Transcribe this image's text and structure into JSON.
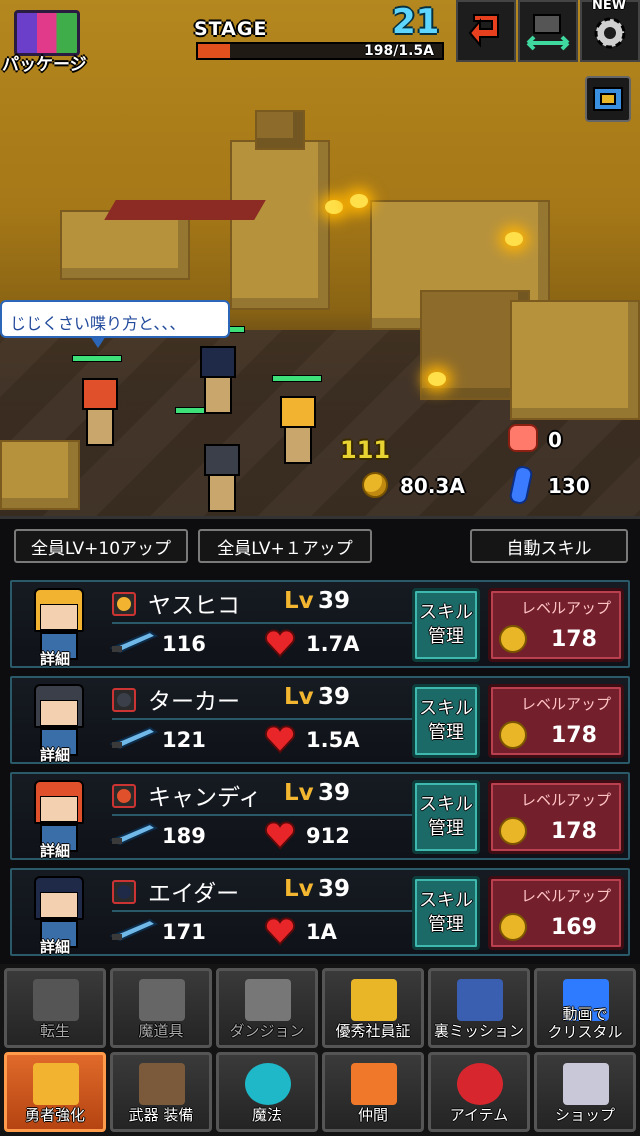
{
  "header": {
    "package_label": "パッケージ",
    "stage_label": "STAGE",
    "stage_number": "21",
    "stage_progress_text": "198/1.5A",
    "stage_progress": 0.13,
    "new_badge": "NEW"
  },
  "scene": {
    "speech": "じじくさい喋り方と、、、",
    "damage_text": "111",
    "coins": "80.3A",
    "meat": "0",
    "crystals": "130"
  },
  "actions": {
    "all_lv10": "全員LV+10アップ",
    "all_lv1": "全員LV+１アップ",
    "auto_skill": "自動スキル"
  },
  "common": {
    "detail": "詳細",
    "skill_manage_1": "スキル",
    "skill_manage_2": "管理",
    "level_up": "レベルアップ",
    "lv": "Lv"
  },
  "heroes": [
    {
      "name": "ヤスヒコ",
      "level": "39",
      "attack": "116",
      "hp": "1.7A",
      "cost": "178",
      "hair": "#f2b430"
    },
    {
      "name": "ターカー",
      "level": "39",
      "attack": "121",
      "hp": "1.5A",
      "cost": "178",
      "hair": "#3a3f4a"
    },
    {
      "name": "キャンディ",
      "level": "39",
      "attack": "189",
      "hp": "912",
      "cost": "178",
      "hair": "#e0502a"
    },
    {
      "name": "エイダー",
      "level": "39",
      "attack": "171",
      "hp": "1A",
      "cost": "169",
      "hair": "#1f2a48"
    }
  ],
  "nav": {
    "row1": [
      "転生",
      "魔道具",
      "ダンジョン",
      "優秀社員証",
      "裏ミッション",
      "動画で\nクリスタル"
    ],
    "row2": [
      "勇者強化",
      "武器 装備",
      "魔法",
      "仲間",
      "アイテム",
      "ショップ"
    ]
  },
  "colors": {
    "accent": "#e2501e",
    "stage": "#5fd6ff",
    "skill": "#1b6a67",
    "levelup": "#731f2c",
    "gold": "#f2b630"
  }
}
